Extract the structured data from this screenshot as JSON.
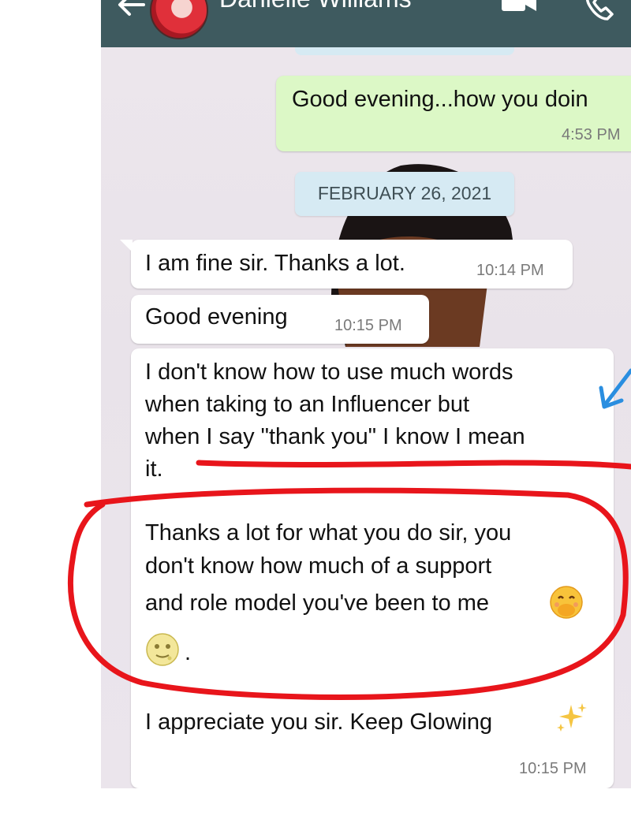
{
  "header": {
    "contact_name": "Danielle Williams",
    "back_icon": "arrow-left-icon",
    "video_icon": "video-call-icon",
    "phone_icon": "phone-call-icon"
  },
  "messages": [
    {
      "direction": "outgoing",
      "text": "Good evening...how you doin",
      "time": "4:53 PM"
    },
    {
      "direction": "incoming",
      "text": "I am fine sir. Thanks a lot.",
      "time": "10:14 PM"
    },
    {
      "direction": "incoming",
      "text": "Good evening",
      "time": "10:15 PM"
    },
    {
      "direction": "incoming",
      "lines": [
        "I don't know how to use much words",
        "when taking to an Influencer but",
        "when I say \"thank you\" I know I mean",
        "it."
      ],
      "lines2": [
        "Thanks a lot for what you do sir, you",
        "don't know how much of a support",
        "and role model you've been to me",
        "."
      ],
      "line3": "I appreciate you sir. Keep Glowing",
      "time": "10:15 PM",
      "emojis": [
        "face-with-hand-over-mouth-emoji",
        "moon-face-emoji",
        "sparkles-emoji"
      ]
    }
  ],
  "date_separator": "FEBRUARY 26, 2021",
  "colors": {
    "header": "#3e5a5f",
    "outgoing_bubble": "#dcf8c6",
    "incoming_bubble": "#ffffff",
    "date_chip": "#d6eaf3",
    "annotation_red": "#e8151b",
    "annotation_blue": "#2a8ee0"
  }
}
